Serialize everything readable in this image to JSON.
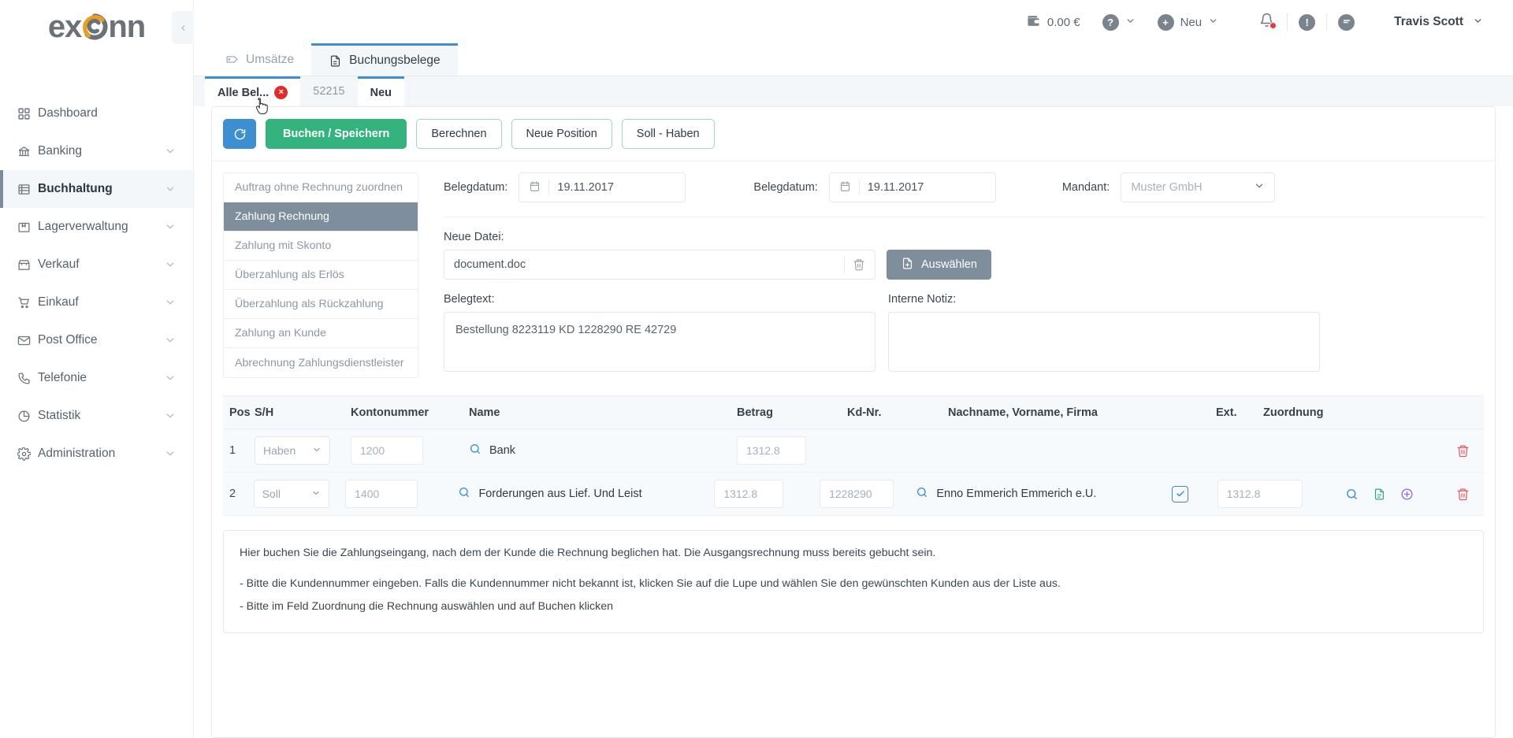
{
  "brand": {
    "logo_text": "exonn",
    "accent_color": "#E8A020",
    "logo_color": "#6b7177"
  },
  "sidebar": {
    "items": [
      {
        "label": "Dashboard",
        "icon": "grid-icon",
        "expandable": false,
        "active": false
      },
      {
        "label": "Banking",
        "icon": "bank-icon",
        "expandable": true,
        "active": false
      },
      {
        "label": "Buchhaltung",
        "icon": "ledger-icon",
        "expandable": true,
        "active": true
      },
      {
        "label": "Lagerverwaltung",
        "icon": "box-icon",
        "expandable": true,
        "active": false
      },
      {
        "label": "Verkauf",
        "icon": "store-icon",
        "expandable": true,
        "active": false
      },
      {
        "label": "Einkauf",
        "icon": "cart-icon",
        "expandable": true,
        "active": false
      },
      {
        "label": "Post Office",
        "icon": "envelope-icon",
        "expandable": true,
        "active": false
      },
      {
        "label": "Telefonie",
        "icon": "phone-icon",
        "expandable": true,
        "active": false
      },
      {
        "label": "Statistik",
        "icon": "pie-chart-icon",
        "expandable": true,
        "active": false
      },
      {
        "label": "Administration",
        "icon": "gear-icon",
        "expandable": true,
        "active": false
      }
    ]
  },
  "topbar": {
    "balance": "0.00 €",
    "wallet_icon": "wallet-icon",
    "help_icon": "question-circle-icon",
    "new_label": "Neu",
    "new_icon": "plus-circle-icon",
    "bell_icon": "bell-icon",
    "alert_icon": "exclamation-circle-icon",
    "message_icon": "message-circle-icon",
    "user_name": "Travis Scott",
    "notification_color": "#f5333f"
  },
  "page_tabs": [
    {
      "label": "Umsätze",
      "icon": "tag-icon",
      "active": false
    },
    {
      "label": "Buchungsbelege",
      "icon": "document-icon",
      "active": true
    }
  ],
  "doc_tabs": [
    {
      "label": "Alle Bel...",
      "active": true,
      "closable": true,
      "close_glyph": "×"
    },
    {
      "label": "52215",
      "active": false,
      "closable": false
    },
    {
      "label": "Neu",
      "active": false,
      "closable": false
    }
  ],
  "toolbar": {
    "refresh_icon": "refresh-icon",
    "save_label": "Buchen / Speichern",
    "calc_label": "Berechnen",
    "new_position_label": "Neue Position",
    "soll_haben_label": "Soll - Haben",
    "primary_color": "#34b37e",
    "refresh_color": "#3d8fd1"
  },
  "choices": {
    "items": [
      {
        "label": "Auftrag ohne Rechnung zuordnen",
        "selected": false
      },
      {
        "label": "Zahlung Rechnung",
        "selected": true
      },
      {
        "label": "Zahlung mit Skonto",
        "selected": false
      },
      {
        "label": "Überzahlung als Erlös",
        "selected": false
      },
      {
        "label": "Überzahlung als Rückzahlung",
        "selected": false
      },
      {
        "label": "Zahlung an Kunde",
        "selected": false
      },
      {
        "label": "Abrechnung Zahlungsdienstleister",
        "selected": false
      }
    ]
  },
  "form": {
    "belegdatum1_label": "Belegdatum:",
    "belegdatum1_value": "19.11.2017",
    "belegdatum2_label": "Belegdatum:",
    "belegdatum2_value": "19.11.2017",
    "mandant_label": "Mandant:",
    "mandant_value": "Muster GmbH",
    "calendar_icon": "calendar-icon",
    "chevron_icon": "chevron-down-icon",
    "neue_datei_label": "Neue Datei:",
    "file_name": "document.doc",
    "trash_icon": "trash-icon",
    "select_file_label": "Auswählen",
    "select_file_icon": "file-upload-icon",
    "belegtext_label": "Belegtext:",
    "belegtext_value": "Bestellung 8223119 KD 1228290 RE 42729",
    "interne_notiz_label": "Interne Notiz:",
    "interne_notiz_value": ""
  },
  "table": {
    "headers": {
      "pos": "Pos",
      "sh": "S/H",
      "kontonummer": "Kontonummer",
      "name": "Name",
      "betrag": "Betrag",
      "kd_nr": "Kd-Nr.",
      "nachname": "Nachname, Vorname, Firma",
      "ext": "Ext.",
      "zuordnung": "Zuordnung"
    },
    "rows": [
      {
        "pos": "1",
        "sh": "Haben",
        "kontonummer": "1200",
        "name": "Bank",
        "betrag": "1312.8",
        "kd_nr": "",
        "nachname": "",
        "ext_checked": false,
        "zuordnung": "",
        "show_extra_actions": false
      },
      {
        "pos": "2",
        "sh": "Soll",
        "kontonummer": "1400",
        "name": "Forderungen aus Lief. Und Leist",
        "betrag": "1312.8",
        "kd_nr": "1228290",
        "nachname": "Enno Emmerich Emmerich e.U.",
        "ext_checked": true,
        "zuordnung": "1312.8",
        "show_extra_actions": true
      }
    ],
    "icons": {
      "search": "search-icon",
      "document": "document-plus-icon",
      "add": "plus-circle-icon",
      "delete": "trash-icon"
    }
  },
  "infobox": {
    "line1": "Hier buchen Sie die Zahlungseingang, nach dem der Kunde die Rechnung beglichen hat. Die Ausgangsrechnung muss bereits gebucht sein.",
    "line2": "- Bitte die Kundennummer eingeben. Falls die Kundennummer nicht bekannt ist, klicken Sie auf die Lupe und wählen Sie den gewünschten Kunden aus der Liste aus.",
    "line3": "- Bitte im Feld Zuordnung die Rechnung auswählen und auf Buchen klicken"
  }
}
